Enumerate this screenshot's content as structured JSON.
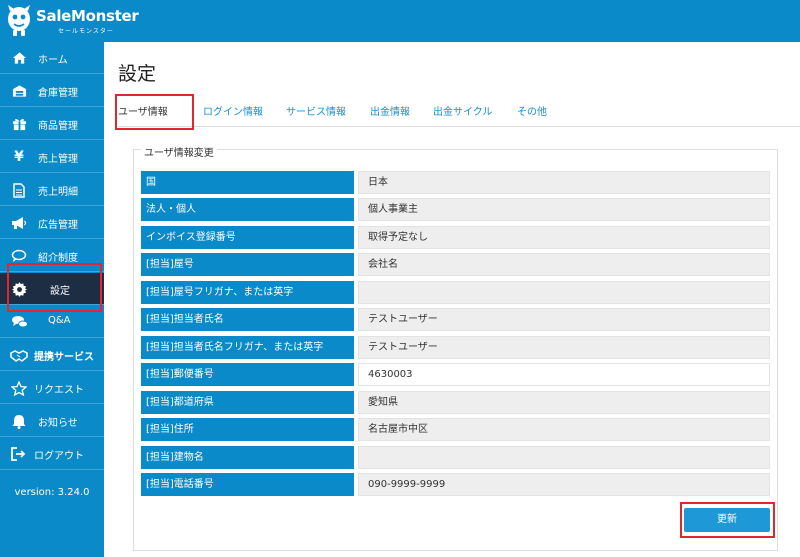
{
  "app": {
    "logo_text": "SaleMonster",
    "logo_subtext": "セールモンスター"
  },
  "sidebar": {
    "items": [
      {
        "label": "ホーム",
        "icon": "home-icon"
      },
      {
        "label": "倉庫管理",
        "icon": "warehouse-icon"
      },
      {
        "label": "商品管理",
        "icon": "gift-icon"
      },
      {
        "label": "売上管理",
        "icon": "yen-icon"
      },
      {
        "label": "売上明細",
        "icon": "document-icon"
      },
      {
        "label": "広告管理",
        "icon": "megaphone-icon"
      },
      {
        "label": "紹介制度",
        "icon": "speech-bubble-icon"
      },
      {
        "label": "設定",
        "icon": "gear-icon"
      },
      {
        "label": "Q&A",
        "icon": "chat-bubbles-icon"
      },
      {
        "label": "提携サービス",
        "icon": "handshake-icon"
      },
      {
        "label": "リクエスト",
        "icon": "star-icon"
      },
      {
        "label": "お知らせ",
        "icon": "bell-icon"
      },
      {
        "label": "ログアウト",
        "icon": "logout-icon"
      }
    ],
    "active_index": 7,
    "version": "version: 3.24.0"
  },
  "page": {
    "title": "設定",
    "tabs": [
      "ユーザ情報",
      "ログイン情報",
      "サービス情報",
      "出金情報",
      "出金サイクル",
      "その他"
    ],
    "active_tab": 0
  },
  "form": {
    "legend": "ユーザ情報変更",
    "rows": [
      {
        "label": "国",
        "value": "日本"
      },
      {
        "label": "法人・個人",
        "value": "個人事業主"
      },
      {
        "label": "インボイス登録番号",
        "value": "取得予定なし"
      },
      {
        "label": "[担当]屋号",
        "value": "会社名"
      },
      {
        "label": "[担当]屋号フリガナ、または英字",
        "value": ""
      },
      {
        "label": "[担当]担当者氏名",
        "value": "テストユーザー"
      },
      {
        "label": "[担当]担当者氏名フリガナ、または英字",
        "value": "テストユーザー"
      },
      {
        "label": "[担当]郵便番号",
        "value": "4630003"
      },
      {
        "label": "[担当]都道府県",
        "value": "愛知県"
      },
      {
        "label": "[担当]住所",
        "value": "名古屋市中区"
      },
      {
        "label": "[担当]建物名",
        "value": ""
      },
      {
        "label": "[担当]電話番号",
        "value": "090-9999-9999"
      }
    ],
    "submit_label": "更新"
  },
  "colors": {
    "brand": "#0a8ac9",
    "sidebar_active": "#1d2d44",
    "highlight": "#e0262f",
    "button": "#1e98d6"
  }
}
